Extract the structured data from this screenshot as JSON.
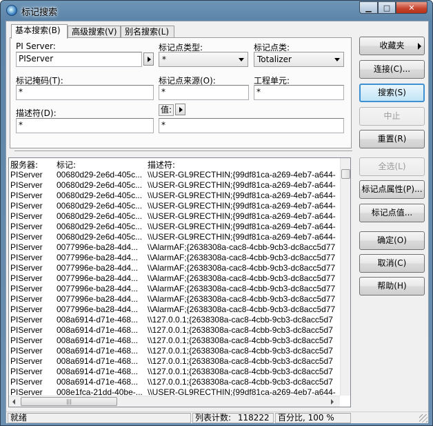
{
  "window": {
    "title": "标记搜索",
    "minimize_glyph": "▁",
    "maximize_glyph": "□",
    "close_glyph": "✕"
  },
  "tabs": [
    {
      "label": "基本搜索(B)",
      "active": true
    },
    {
      "label": "高级搜索(V)",
      "active": false
    },
    {
      "label": "别名搜索(L)",
      "active": false
    }
  ],
  "form": {
    "pi_server_label": "PI Server:",
    "pi_server_value": "PIServer",
    "point_type_label": "标记点类型:",
    "point_type_value": "*",
    "point_class_label": "标记点类:",
    "point_class_value": "Totalizer",
    "tag_mask_label": "标记掩码(T):",
    "tag_mask_value": "*",
    "point_source_label": "标记点来源(O):",
    "point_source_value": "*",
    "eng_units_label": "工程单元:",
    "eng_units_value": "*",
    "descriptor_label": "描述符(D):",
    "descriptor_value": "*",
    "value_label": "值:",
    "value_value": "*"
  },
  "buttons": {
    "favorites": "收藏夹",
    "connect": "连接(C)...",
    "search": "搜索(S)",
    "stop": "中止",
    "reset": "重置(R)",
    "select_all": "全选(L)",
    "point_attributes": "标记点属性(P)...",
    "point_values": "标记点值...",
    "ok": "确定(O)",
    "cancel": "取消(C)",
    "help": "帮助(H)"
  },
  "table": {
    "columns": [
      "服务器:",
      "标记:",
      "描述符:"
    ],
    "rows": [
      [
        "PIServer",
        "00680d29-2e6d-405c...",
        "\\\\USER-GL9RECTHIN;{99df81ca-a269-4eb7-a644-"
      ],
      [
        "PIServer",
        "00680d29-2e6d-405c...",
        "\\\\USER-GL9RECTHIN;{99df81ca-a269-4eb7-a644-"
      ],
      [
        "PIServer",
        "00680d29-2e6d-405c...",
        "\\\\USER-GL9RECTHIN;{99df81ca-a269-4eb7-a644-"
      ],
      [
        "PIServer",
        "00680d29-2e6d-405c...",
        "\\\\USER-GL9RECTHIN;{99df81ca-a269-4eb7-a644-"
      ],
      [
        "PIServer",
        "00680d29-2e6d-405c...",
        "\\\\USER-GL9RECTHIN;{99df81ca-a269-4eb7-a644-"
      ],
      [
        "PIServer",
        "00680d29-2e6d-405c...",
        "\\\\USER-GL9RECTHIN;{99df81ca-a269-4eb7-a644-"
      ],
      [
        "PIServer",
        "00680d29-2e6d-405c...",
        "\\\\USER-GL9RECTHIN;{99df81ca-a269-4eb7-a644-"
      ],
      [
        "PIServer",
        "0077996e-ba28-4d4...",
        "\\\\AlarmAF;{2638308a-cac8-4cbb-9cb3-dc8acc5d77"
      ],
      [
        "PIServer",
        "0077996e-ba28-4d4...",
        "\\\\AlarmAF;{2638308a-cac8-4cbb-9cb3-dc8acc5d77"
      ],
      [
        "PIServer",
        "0077996e-ba28-4d4...",
        "\\\\AlarmAF;{2638308a-cac8-4cbb-9cb3-dc8acc5d77"
      ],
      [
        "PIServer",
        "0077996e-ba28-4d4...",
        "\\\\AlarmAF;{2638308a-cac8-4cbb-9cb3-dc8acc5d77"
      ],
      [
        "PIServer",
        "0077996e-ba28-4d4...",
        "\\\\AlarmAF;{2638308a-cac8-4cbb-9cb3-dc8acc5d77"
      ],
      [
        "PIServer",
        "0077996e-ba28-4d4...",
        "\\\\AlarmAF;{2638308a-cac8-4cbb-9cb3-dc8acc5d77"
      ],
      [
        "PIServer",
        "0077996e-ba28-4d4...",
        "\\\\AlarmAF;{2638308a-cac8-4cbb-9cb3-dc8acc5d77"
      ],
      [
        "PIServer",
        "008a6914-d71e-468...",
        "\\\\127.0.0.1;{2638308a-cac8-4cbb-9cb3-dc8acc5d7"
      ],
      [
        "PIServer",
        "008a6914-d71e-468...",
        "\\\\127.0.0.1;{2638308a-cac8-4cbb-9cb3-dc8acc5d7"
      ],
      [
        "PIServer",
        "008a6914-d71e-468...",
        "\\\\127.0.0.1;{2638308a-cac8-4cbb-9cb3-dc8acc5d7"
      ],
      [
        "PIServer",
        "008a6914-d71e-468...",
        "\\\\127.0.0.1;{2638308a-cac8-4cbb-9cb3-dc8acc5d7"
      ],
      [
        "PIServer",
        "008a6914-d71e-468...",
        "\\\\127.0.0.1;{2638308a-cac8-4cbb-9cb3-dc8acc5d7"
      ],
      [
        "PIServer",
        "008a6914-d71e-468...",
        "\\\\127.0.0.1;{2638308a-cac8-4cbb-9cb3-dc8acc5d7"
      ],
      [
        "PIServer",
        "008a6914-d71e-468...",
        "\\\\127.0.0.1;{2638308a-cac8-4cbb-9cb3-dc8acc5d7"
      ],
      [
        "PIServer",
        "008e1fca-21dd-40be-...",
        "\\\\USER-GL9RECTHIN;{99df81ca-a269-4eb7-a644-"
      ]
    ],
    "hscroll_grip": "|||"
  },
  "status": {
    "ready": "就绪",
    "count_label": "列表计数:",
    "count_value": "118222",
    "percent": "百分比, 100 %"
  },
  "colors": {
    "title_gradient": "#5c84a8",
    "close_button": "#c4422b",
    "default_button_border": "#3c8fd0",
    "face": "#f0f0f0"
  }
}
